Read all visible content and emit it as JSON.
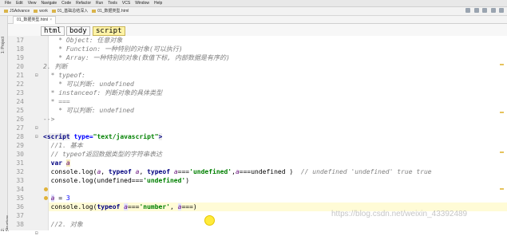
{
  "menu": [
    "File",
    "Edit",
    "View",
    "Navigate",
    "Code",
    "Refactor",
    "Run",
    "Tools",
    "VCS",
    "Window",
    "Help"
  ],
  "nav_crumbs": [
    "JSAdvance",
    "work",
    "01_基础总结深入",
    "01_数据类型.html"
  ],
  "tabs": [
    {
      "label": "01_数据类型.html",
      "active": true
    }
  ],
  "side_panel_labels": [
    "1: Project",
    "2: Structure"
  ],
  "tag_breadcrumb": [
    "html",
    "body",
    "script"
  ],
  "current_line": 36,
  "lines": [
    {
      "num": 17,
      "html": "    <span class=\"c\">* Object: 任意对象</span>"
    },
    {
      "num": 18,
      "html": "    <span class=\"c\">* Function: 一种特别的对象(可以执行)</span>"
    },
    {
      "num": 19,
      "html": "    <span class=\"c\">* Array: 一种特别的对象(数值下标, 内部数据是有序的)</span>"
    },
    {
      "num": 20,
      "html": "<span class=\"c\">2. 判断</span>"
    },
    {
      "num": 21,
      "html": "  <span class=\"c\">* typeof:</span>"
    },
    {
      "num": 22,
      "html": "    <span class=\"c\">* 可以判断: undefined</span>"
    },
    {
      "num": 23,
      "html": "  <span class=\"c\">* instanceof: 判断对象的具体类型</span>"
    },
    {
      "num": 24,
      "html": "  <span class=\"c\">* ===</span>"
    },
    {
      "num": 25,
      "html": "    <span class=\"c\">* 可以判断: undefined</span>"
    },
    {
      "num": 26,
      "html": "<span class=\"c\">--&gt;</span>"
    },
    {
      "num": 27,
      "html": ""
    },
    {
      "num": 28,
      "html": "<span class=\"tg\">&lt;script</span> <span class=\"at\">type=</span><span class=\"av\">\"text/javascript\"</span><span class=\"tg\">&gt;</span>"
    },
    {
      "num": 29,
      "html": "  <span class=\"c\">//1. 基本</span>"
    },
    {
      "num": 30,
      "html": "  <span class=\"c\">// typeof返回数据类型的字符串表达</span>"
    },
    {
      "num": 31,
      "html": "  <span class=\"k\">var</span> <span class=\"v warn\">a</span>"
    },
    {
      "num": 32,
      "html": "  console.log(<span class=\"v\">a</span>, <span class=\"k\">typeof</span> <span class=\"v\">a</span>, <span class=\"k\">typeof</span> <span class=\"v\">a</span>===<span class=\"s\">'undefined'</span>,<span class=\"v\">a</span>===undefined )  <span class=\"c\">// undefined 'undefined' true true</span>"
    },
    {
      "num": 33,
      "html": "  console.log(undefined===<span class=\"s\">'undefined'</span>)"
    },
    {
      "num": 34,
      "html": ""
    },
    {
      "num": 35,
      "html": "  <span class=\"v hlv\">a</span> = <span class=\"k\" style=\"color:#0000ff;font-weight:normal\">3</span>"
    },
    {
      "num": 36,
      "html": "  console.log(<span class=\"k\">typeof</span> <span class=\"v hlv\">a</span>===<span class=\"s\">'number'</span>, <span class=\"v hlv\">a</span>===)"
    },
    {
      "num": 37,
      "html": ""
    },
    {
      "num": 38,
      "html": "  <span class=\"c\">//2. 对象</span>"
    }
  ],
  "watermark": "https://blog.csdn.net/weixin_43392489"
}
